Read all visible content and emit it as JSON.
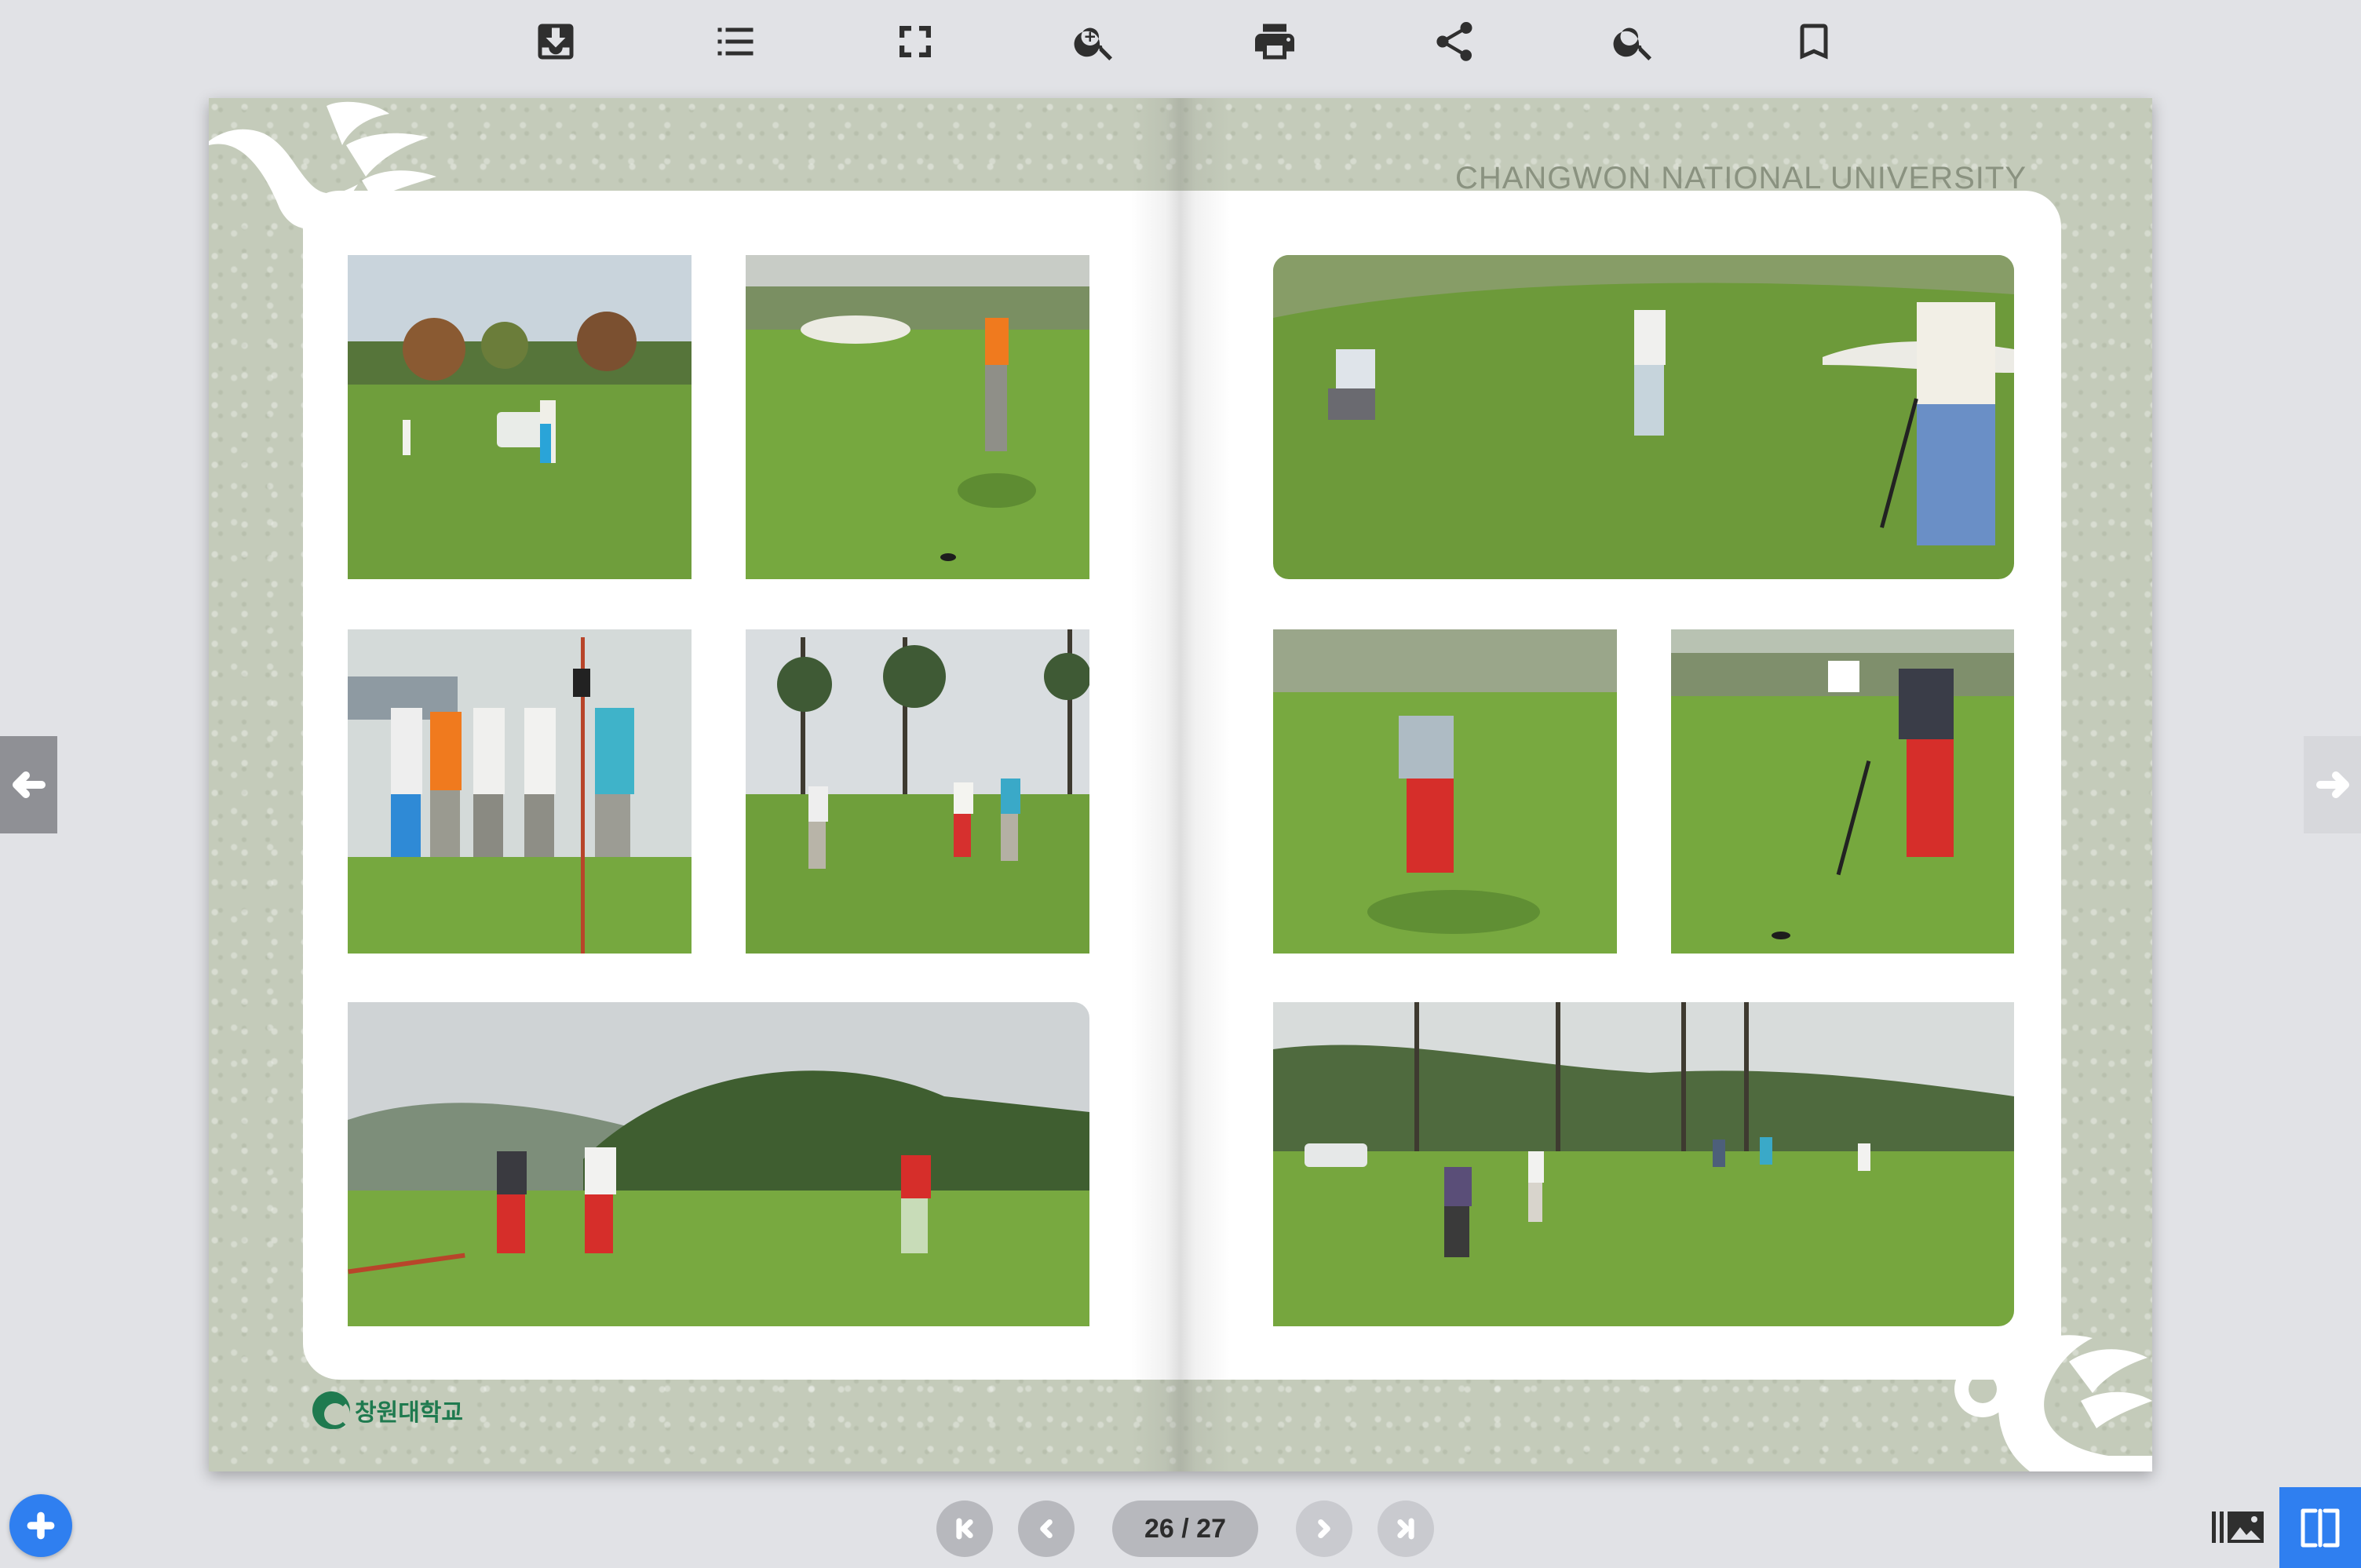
{
  "toolbar": {
    "items": [
      {
        "name": "download-icon",
        "label": "Download"
      },
      {
        "name": "table-of-contents-icon",
        "label": "Contents"
      },
      {
        "name": "fullscreen-icon",
        "label": "Fullscreen"
      },
      {
        "name": "zoom-in-icon",
        "label": "Zoom"
      },
      {
        "name": "print-icon",
        "label": "Print"
      },
      {
        "name": "share-icon",
        "label": "Share"
      },
      {
        "name": "search-icon",
        "label": "Search"
      },
      {
        "name": "bookmark-icon",
        "label": "Bookmark"
      }
    ]
  },
  "book": {
    "header_title": "CHANGWON NATIONAL UNIVERSITY",
    "header_title_shadow": "CHANGWON NATIONAL UNIVERSITY",
    "logo_text": "창원대학교",
    "photos": [
      {
        "page": "left",
        "subject": "golfer putting near cart"
      },
      {
        "page": "left",
        "subject": "golfer in orange shirt putting"
      },
      {
        "page": "left",
        "subject": "group of five golfers by flag"
      },
      {
        "page": "left",
        "subject": "three golfers on green with pines"
      },
      {
        "page": "left",
        "subject": "golfers in red trousers on green"
      },
      {
        "page": "right",
        "subject": "golfers reading a putt"
      },
      {
        "page": "right",
        "subject": "golfer in red trousers putting"
      },
      {
        "page": "right",
        "subject": "golfer in dark shirt putting"
      },
      {
        "page": "right",
        "subject": "wide view of green with golfers"
      }
    ]
  },
  "navigation": {
    "page_indicator": "26 / 27",
    "first_page": "first-page-button",
    "prev_page": "previous-page-button",
    "next_page": "next-page-button",
    "last_page": "last-page-button"
  },
  "colors": {
    "accent": "#2f7ff0",
    "background": "#e1e2e6",
    "book_border": "#c4cbba",
    "logo_green": "#1f7a4f"
  }
}
